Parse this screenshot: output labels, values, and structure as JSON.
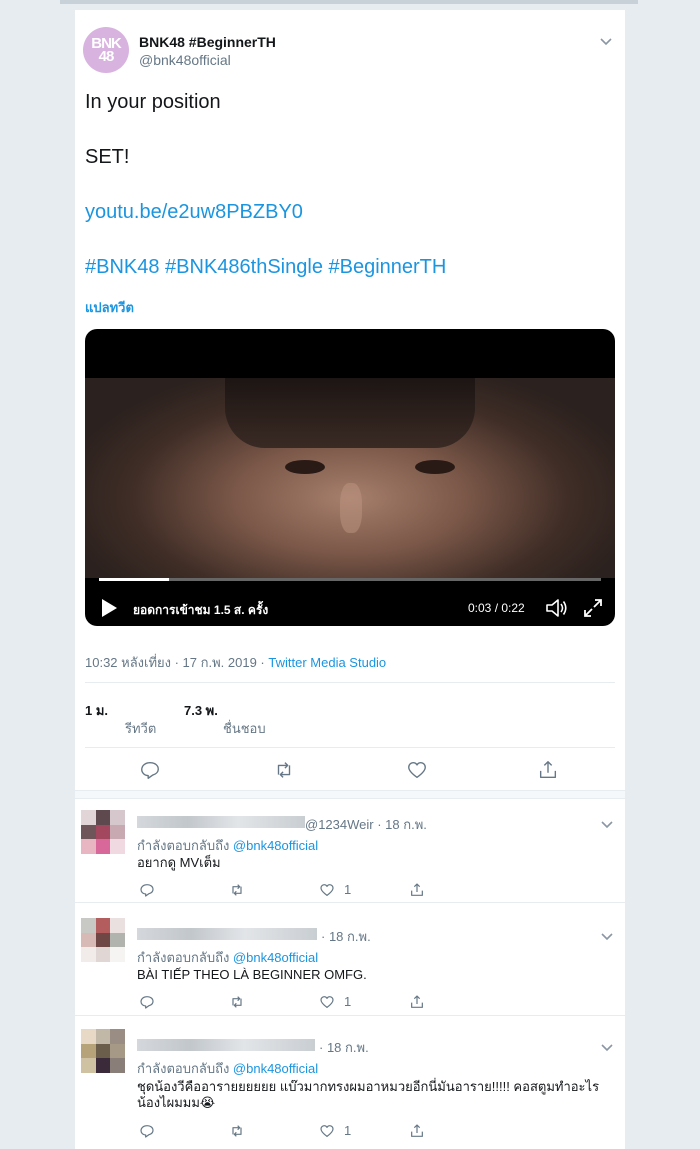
{
  "tweet": {
    "author": {
      "name": "BNK48 #BeginnerTH",
      "handle": "@bnk48official",
      "avatar_text": "BNK48",
      "avatar_color": "#d9b3e0"
    },
    "lines": [
      "In your position",
      "SET!"
    ],
    "link": "youtu.be/e2uw8PBZBY0",
    "hashtags": "#BNK48 #BNK486thSingle #BeginnerTH",
    "translate_label": "แปลทวีต",
    "video": {
      "views": "ยอดการเข้าชม 1.5 ส. ครั้ง",
      "time": "0:03 / 0:22",
      "progress_fraction": 0.14
    },
    "meta": {
      "timestamp": "10:32 หลังเที่ยง · 17 ก.พ. 2019 · ",
      "source": "Twitter Media Studio"
    },
    "stats": {
      "retweets_count": "1 ม.",
      "retweets_label": "รีทวีต",
      "likes_count": "7.3 พ.",
      "likes_label": "ชื่นชอบ"
    },
    "actions": [
      "reply-icon",
      "retweet-icon",
      "like-icon",
      "share-icon"
    ]
  },
  "replies": [
    {
      "handle_meta": "@1234Weir · 18 ก.พ.",
      "replying_prefix": "กำลังตอบกลับถึง ",
      "replying_to": "@bnk48official",
      "text": "อยากดู MVเต็ม",
      "likes": "1"
    },
    {
      "handle_meta": "· 18 ก.พ.",
      "replying_prefix": "กำลังตอบกลับถึง ",
      "replying_to": "@bnk48official",
      "text": "BÀI TIẾP THEO LÀ BEGINNER OMFG.",
      "likes": "1"
    },
    {
      "handle_meta": "· 18 ก.พ.",
      "replying_prefix": "กำลังตอบกลับถึง ",
      "replying_to": "@bnk48official",
      "text": "ชุดน้องวีคืออารายยยยยย แบ๊วมากทรงผมอาหมวยอีกนี่มันอาราย!!!!! คอสตูมทำอะไรน้องไผมมม😭",
      "likes": "1"
    }
  ],
  "colors": {
    "link": "#1b95e0",
    "background": "#e6ecf0",
    "secondary_text": "#657786"
  }
}
